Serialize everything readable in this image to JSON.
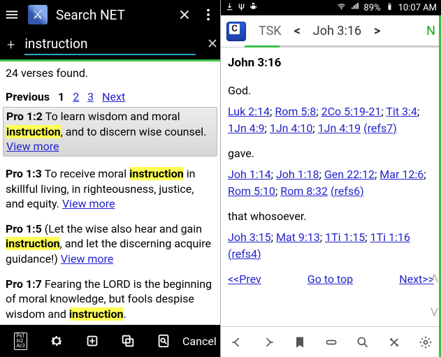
{
  "left": {
    "title": "Search NET",
    "search_value": "instruction",
    "found_text": "24 verses found.",
    "pager": {
      "label": "Previous",
      "pages": [
        "1",
        "2",
        "3"
      ],
      "next": "Next"
    },
    "results": [
      {
        "ref": "Pro 1:2",
        "pre": "To learn wisdom and moral ",
        "hit": "instruction",
        "post": ", and to discern wise counsel.",
        "more": "View more",
        "active": true
      },
      {
        "ref": "Pro 1:3",
        "pre": "To receive moral ",
        "hit": "instruction",
        "post": " in skillful living, in righteousness, justice, and equity.",
        "more": "View more",
        "active": false
      },
      {
        "ref": "Pro 1:5",
        "pre": "(Let the wise also hear and gain ",
        "hit": "instruction",
        "post": ", and let the discerning acquire guidance!)",
        "more": "View more",
        "active": false
      },
      {
        "ref": "Pro 1:7",
        "pre": "Fearing the LORD is the beginning of moral knowledge, but fools despise wisdom and ",
        "hit": "instruction",
        "post": ".",
        "more": null,
        "active": false
      }
    ],
    "footer_cancel": "Cancel"
  },
  "right": {
    "status": {
      "battery": "89%",
      "time": "10:07 AM"
    },
    "header": {
      "module": "TSK",
      "passage": "Joh 3:16"
    },
    "title": "John 3:16",
    "sections": [
      {
        "word": "God.",
        "refs": [
          "Luk 2:14",
          "Rom 5:8",
          "2Co 5:19-21",
          "Tit 3:4",
          "1Jn 4:9",
          "1Jn 4:10",
          "1Jn 4:19"
        ],
        "group": "(refs7)"
      },
      {
        "word": "gave.",
        "refs": [
          "Joh 1:14",
          "Joh 1:18",
          "Gen 22:12",
          "Mar 12:6",
          "Rom 5:10",
          "Rom 8:32"
        ],
        "group": "(refs6)"
      },
      {
        "word": "that whosoever.",
        "refs": [
          "Joh 3:15",
          "Mat 9:13",
          "1Ti 1:15",
          "1Ti 1:16"
        ],
        "group": "(refs4)"
      }
    ],
    "nav": {
      "prev": "<<Prev",
      "top": "Go to top",
      "next": "Next>>"
    }
  }
}
